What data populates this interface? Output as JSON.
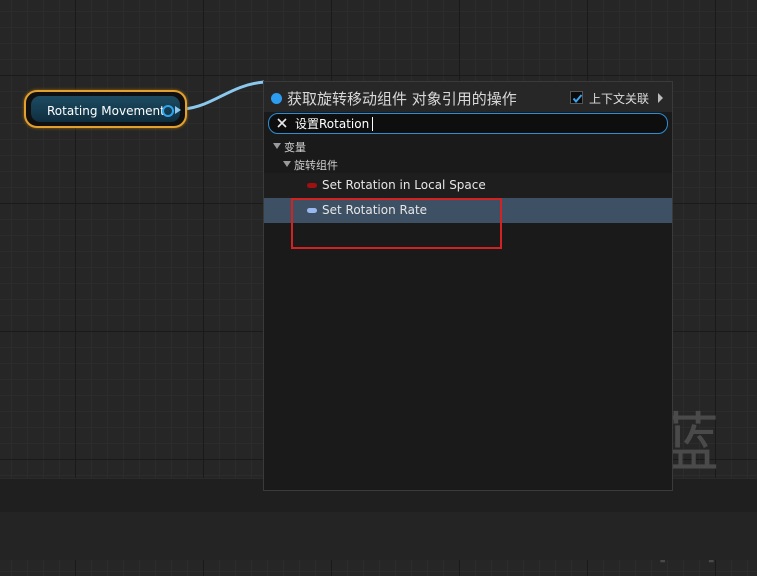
{
  "graph": {
    "node": {
      "label": "Rotating Movement"
    },
    "watermark": "蓝图"
  },
  "action_menu": {
    "title": "获取旋转移动组件 对象引用的操作",
    "context_sensitive": {
      "label": "上下文关联",
      "checked": true
    },
    "search": {
      "value": "设置Rotation",
      "placeholder": ""
    },
    "categories": [
      {
        "label": "变量",
        "subcategories": [
          {
            "label": "旋转组件",
            "items": [
              {
                "label": "Set Rotation in Local Space",
                "pill_color": "#a01010",
                "selected": false
              },
              {
                "label": "Set Rotation Rate",
                "pill_color": "#9ab8f0",
                "selected": true
              }
            ]
          }
        ]
      }
    ]
  },
  "colors": {
    "node_border": "#e2a12f",
    "pin": "#2ea4ec",
    "wire": "#8cc8ee",
    "search_border": "#2a8fd6",
    "selection": "#3d5064",
    "annotation": "#d22222"
  }
}
